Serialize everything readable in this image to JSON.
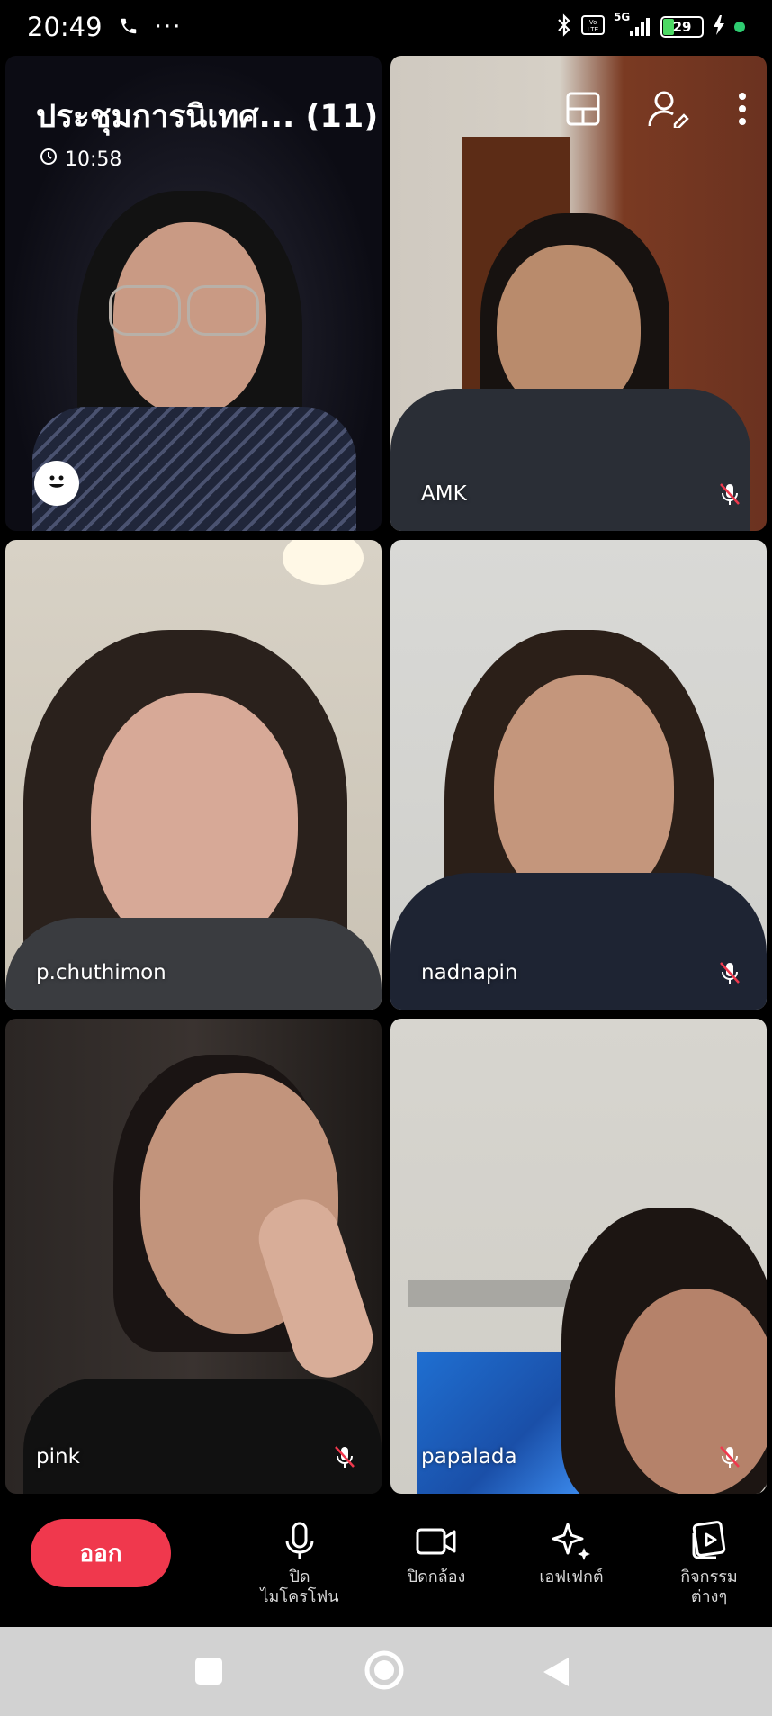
{
  "status_bar": {
    "time": "20:49",
    "battery": "29",
    "network": "5G"
  },
  "call": {
    "title": "ประชุมการนิเทศ... (11)",
    "duration": "10:58"
  },
  "participants": [
    {
      "name": "",
      "muted": false
    },
    {
      "name": "AMK",
      "muted": true
    },
    {
      "name": "p.chuthimon",
      "muted": false
    },
    {
      "name": "nadnapin",
      "muted": true
    },
    {
      "name": "pink",
      "muted": true
    },
    {
      "name": "papalada",
      "muted": true
    }
  ],
  "controls": {
    "leave": "ออก",
    "mic": "ปิด ไมโครโฟน",
    "mic_line1": "ปิด",
    "mic_line2": "ไมโครโฟน",
    "camera": "ปิดกล้อง",
    "effects": "เอฟเฟกต์",
    "activities_line1": "กิจกรรม",
    "activities_line2": "ต่างๆ"
  },
  "colors": {
    "leave_button": "#f0384d",
    "nav_bar": "#d2d2d2"
  }
}
